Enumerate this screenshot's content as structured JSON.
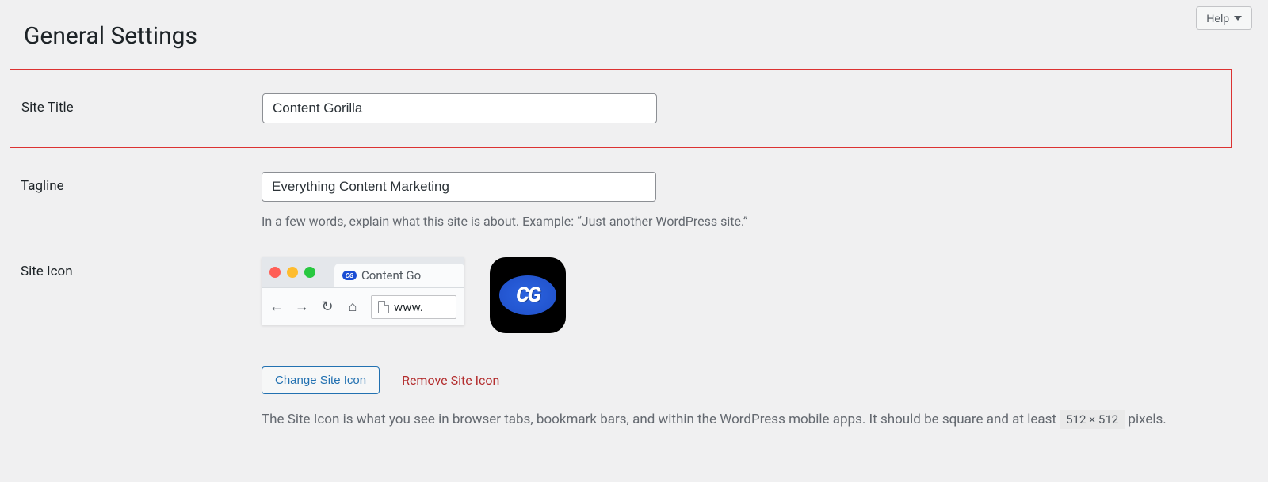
{
  "help": {
    "label": "Help"
  },
  "page": {
    "title": "General Settings"
  },
  "fields": {
    "site_title": {
      "label": "Site Title",
      "value": "Content Gorilla"
    },
    "tagline": {
      "label": "Tagline",
      "value": "Everything Content Marketing",
      "description": "In a few words, explain what this site is about. Example: “Just another WordPress site.”"
    },
    "site_icon": {
      "label": "Site Icon",
      "browser_tab_text": "Content Go",
      "favicon_letters": "CG",
      "address_text": "www.",
      "app_icon_letters": "CG",
      "change_button": "Change Site Icon",
      "remove_button": "Remove Site Icon",
      "description_before": "The Site Icon is what you see in browser tabs, bookmark bars, and within the WordPress mobile apps. It should be square and at least",
      "dimensions": "512 × 512",
      "description_after": "pixels."
    }
  }
}
